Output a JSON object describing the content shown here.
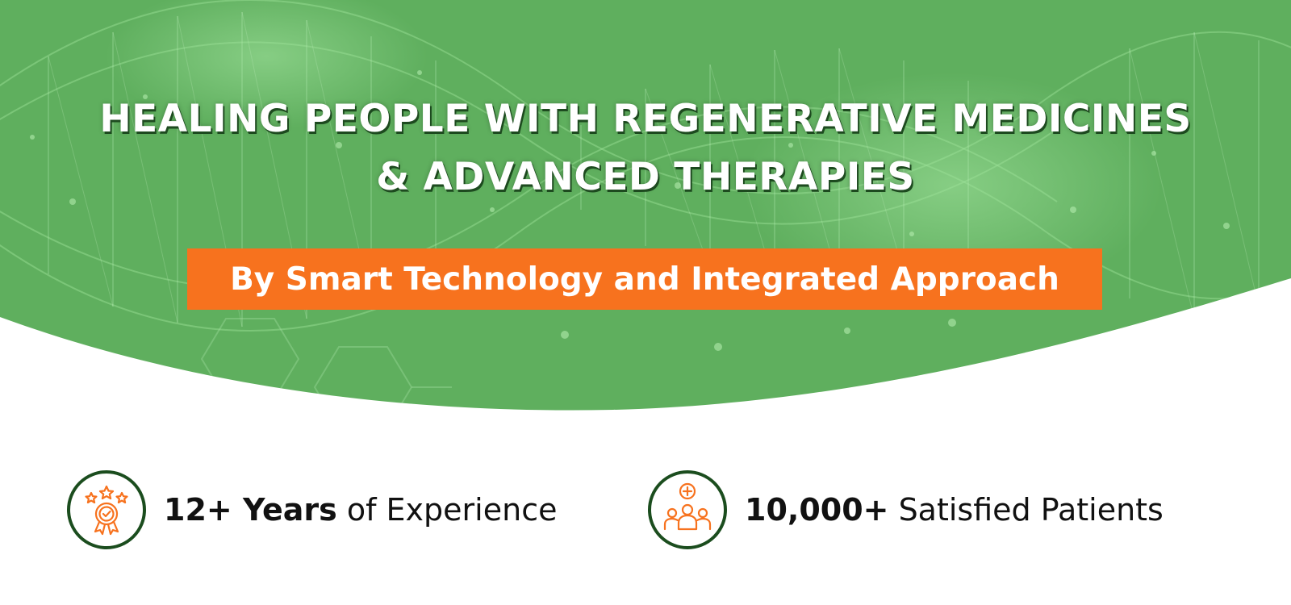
{
  "hero": {
    "headline_line_1": "HEALING PEOPLE WITH REGENERATIVE MEDICINES",
    "headline_line_2": "& ADVANCED THERAPIES",
    "tagline": "By Smart Technology and Integrated Approach"
  },
  "stats": [
    {
      "strong": "12+ Years",
      "rest": " of Experience",
      "icon": "award-ribbon-icon"
    },
    {
      "strong": "10,000+",
      "rest": " Satisfied Patients",
      "icon": "patients-medical-cross-icon"
    }
  ],
  "colors": {
    "hero_green": "#5faf5e",
    "accent_orange": "#f7721e",
    "icon_ring_dark_green": "#1b4d1e",
    "text_dark": "#111111",
    "background": "#ffffff"
  }
}
